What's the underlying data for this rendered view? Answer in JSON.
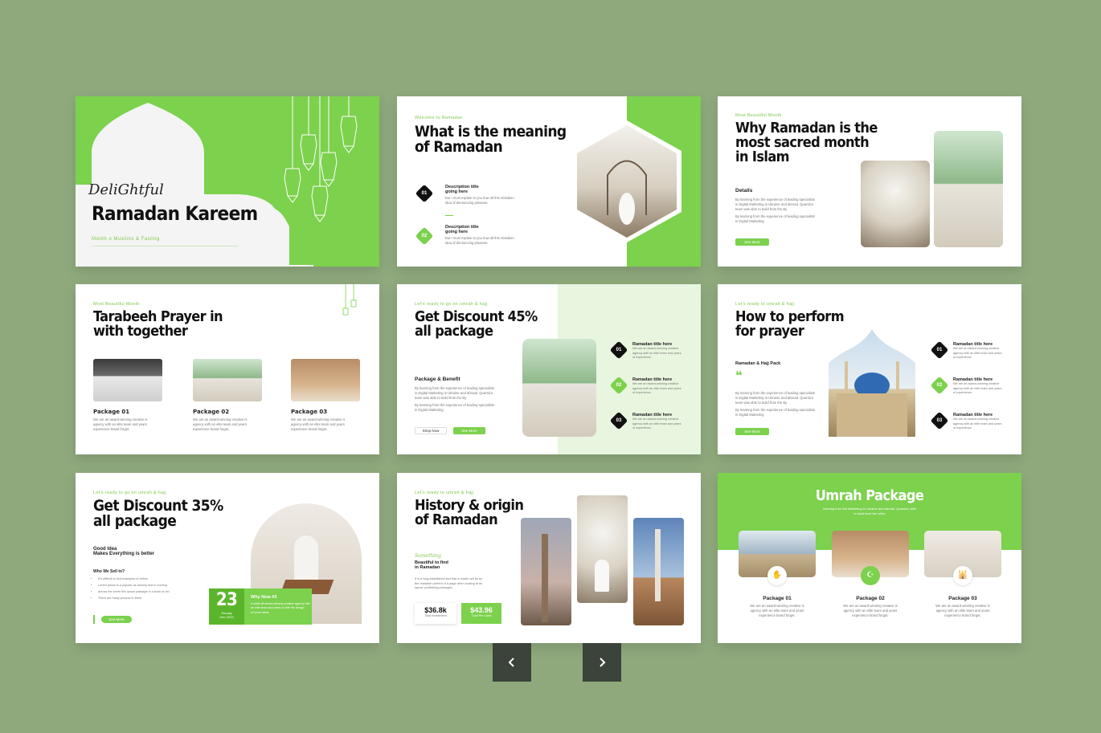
{
  "colors": {
    "accent": "#7cd14d",
    "background": "#8fa97d",
    "dark": "#111111",
    "nav": "#3b433a"
  },
  "slide1": {
    "script_title": "DeliGhtful",
    "title": "Ramadan Kareem",
    "subtitle": "Month o Muslims & Fasting"
  },
  "slide2": {
    "eyebrow": "Welcome to Ramadan",
    "title_line1": "What is the meaning",
    "title_line2": "of Ramadan",
    "items": [
      {
        "num": "01",
        "title_line1": "Description title",
        "title_line2": "going here",
        "text_line1": "But I must explain to you how all this mistaken",
        "text_line2": "idea of denouncing pleasure"
      },
      {
        "num": "02",
        "title_line1": "Description title",
        "title_line2": "going here",
        "text_line1": "But I must explain to you how all this mistaken",
        "text_line2": "idea of denouncing pleasure"
      }
    ]
  },
  "slide3": {
    "eyebrow": "Most Beautiful Month",
    "title_line1": "Why Ramadan is the",
    "title_line2": "most sacred month",
    "title_line3": "in Islam",
    "details_label": "Details",
    "text_line1": "By learning from the experience of leading specialists",
    "text_line2": "in Digital Marketing in Ukraine and abroad. Quantico",
    "text_line3": "team was able to build from the By",
    "text_line4": "By learning from the experience of leading specialists",
    "text_line5": "in Digital Marketing",
    "button": "See More"
  },
  "slide4": {
    "eyebrow": "Most Beautiful Month",
    "title_line1": "Tarabeeh Prayer in",
    "title_line2": "with together",
    "packages": [
      {
        "title": "Package 01",
        "text_line1": "We are an award-winning creative is",
        "text_line2": "agency with an elite team and years",
        "text_line3": "experience brand forget."
      },
      {
        "title": "Package 02",
        "text_line1": "We are an award-winning creative is",
        "text_line2": "agency with an elite team and years",
        "text_line3": "experience brand forget."
      },
      {
        "title": "Package 03",
        "text_line1": "We are an award-winning creative is",
        "text_line2": "agency with an elite team and years",
        "text_line3": "experience brand forget."
      }
    ]
  },
  "slide5": {
    "eyebrow": "Let's ready to go on umrah & hajj",
    "title_line1": "Get Discount 45%",
    "title_line2": "all package",
    "section_title": "Package & Benefit",
    "text_line1": "By learning from the experience of leading specialists",
    "text_line2": "in Digital Marketing in Ukraine and abroad. Quantico",
    "text_line3": "team was able to build from the By",
    "text_line4": "By learning from the experience of leading specialists",
    "text_line5": "in Digital Marketing",
    "btn_shop": "Shop Now",
    "btn_more": "See More",
    "items": [
      {
        "num": "01",
        "title": "Ramadan title here",
        "text_line1": "We are an award-winning creative",
        "text_line2": "agency with an elite team and years",
        "text_line3": "of experience."
      },
      {
        "num": "02",
        "title": "Ramadan title here",
        "text_line1": "We are an award-winning creative",
        "text_line2": "agency with an elite team and years",
        "text_line3": "of experience."
      },
      {
        "num": "03",
        "title": "Ramadan title here",
        "text_line1": "We are an award-winning creative",
        "text_line2": "agency with an elite team and years",
        "text_line3": "of experience."
      }
    ]
  },
  "slide6": {
    "eyebrow": "Let's ready to umrah & hajj",
    "title_line1": "How to perform",
    "title_line2": "for prayer",
    "sub_label": "Ramadan & Hajj Pack",
    "quote_mark": "❝",
    "text_line1": "By learning from the experience of leading specialists",
    "text_line2": "in Digital Marketing in Ukraine and abroad. Quantico",
    "text_line3": "team was able to build from the By",
    "text_line4": "By learning from the experience of leading specialists",
    "text_line5": "in Digital Marketing",
    "button": "See More",
    "items": [
      {
        "num": "01",
        "title": "Ramadan title here",
        "text_line1": "We are an award-winning creative",
        "text_line2": "agency with an elite team and years",
        "text_line3": "of experience."
      },
      {
        "num": "02",
        "title": "Ramadan title here",
        "text_line1": "We are an award-winning creative",
        "text_line2": "agency with an elite team and years",
        "text_line3": "of experience."
      },
      {
        "num": "03",
        "title": "Ramadan title here",
        "text_line1": "We are an award-winning creative",
        "text_line2": "agency with an elite team and years",
        "text_line3": "of experience."
      }
    ]
  },
  "slide7": {
    "eyebrow": "Let's ready to go on umrah & hajj",
    "title_line1": "Get Discount 35%",
    "title_line2": "all package",
    "sub_line1": "Good Idea",
    "sub_line2": "Makes Everything is better",
    "list_title": "Who We Sell to?",
    "list": [
      "It's difficult to find examples of define",
      "Lorem ipsum is a popular as dummy text in coming",
      "across the lorem this ipsum passage in a book of old",
      "There are many product in there"
    ],
    "date_num": "23",
    "date_day": "Sunday",
    "date_month": "Dec 2023",
    "card_title": "Why Now #2",
    "card_text_line1": "A smile all award-winning creative agency with",
    "card_text_line2": "an elite team and years of elite the design",
    "card_text_line3": "of some ideas.",
    "button": "See More"
  },
  "slide8": {
    "eyebrow": "Let's ready to umrah & hajj",
    "title_line1": "History & origin",
    "title_line2": "of Ramadan",
    "something": "Something",
    "sub_line1": "Beautiful to find",
    "sub_line2": "in Ramadan",
    "text_line1": "It is a long established fact that a reader will be by",
    "text_line2": "the readable content of a page when looking at its",
    "text_line3": "layout. publishing packages.",
    "stat1_value": "$36.8k",
    "stat1_label": "Total Investment",
    "stat2_value": "$43.96",
    "stat2_label": "Cost Per Land"
  },
  "slide9": {
    "title": "Umrah Package",
    "sub_line1": "learning from the Marketing in Ukraine and abroad. Quantico able",
    "sub_line2": "to build from the white",
    "packages": [
      {
        "title": "Package 01",
        "icon": "hands-icon",
        "glyph": "✋",
        "text_line1": "We are an award-winning creative is",
        "text_line2": "agency with an elite team and years",
        "text_line3": "experience brand forget."
      },
      {
        "title": "Package 02",
        "icon": "prayer-icon",
        "glyph": "☪",
        "text_line1": "We are an award-winning creative is",
        "text_line2": "agency with an elite team and years",
        "text_line3": "experience brand forget."
      },
      {
        "title": "Package 03",
        "icon": "mosque-icon",
        "glyph": "🕌",
        "text_line1": "We are an award-winning creative is",
        "text_line2": "agency with an elite team and years",
        "text_line3": "experience brand forget."
      }
    ]
  },
  "nav": {
    "prev_icon": "chevron-left-icon",
    "next_icon": "chevron-right-icon"
  }
}
